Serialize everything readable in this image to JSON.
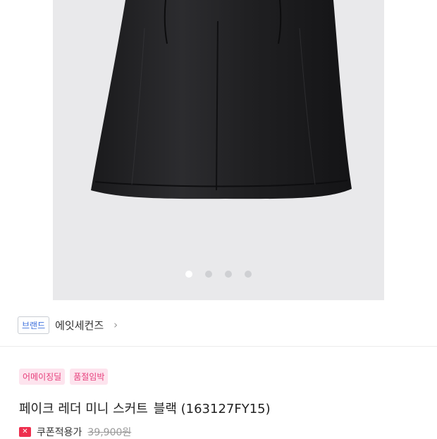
{
  "gallery": {
    "slide_count": 4,
    "active_slide": 1
  },
  "brand": {
    "tag_label": "브랜드",
    "name": "에잇세컨즈",
    "chevron": "›"
  },
  "badges": [
    "어메이징딜",
    "품절임박"
  ],
  "product": {
    "title_part1": "페이크 레더 미니 스커트",
    "title_part2": "블랙 (163127FY15)"
  },
  "price": {
    "coupon_icon": "coupon-icon",
    "coupon_label": "쿠폰적용가",
    "original": "39,900원"
  },
  "colors": {
    "badge_bg": "#fde4ee",
    "badge_text": "#e63d7a",
    "brand_tag_text": "#3d6fdc",
    "coupon_red": "#ee2f4e",
    "image_bg": "#e9e9eb"
  }
}
